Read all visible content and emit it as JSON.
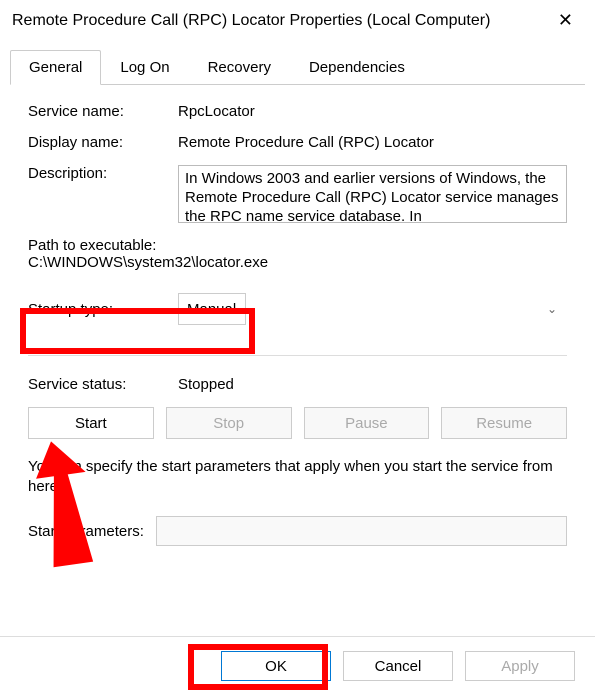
{
  "title": "Remote Procedure Call (RPC) Locator Properties (Local Computer)",
  "tabs": {
    "general": "General",
    "logon": "Log On",
    "recovery": "Recovery",
    "dependencies": "Dependencies"
  },
  "labels": {
    "service_name": "Service name:",
    "display_name": "Display name:",
    "description": "Description:",
    "path": "Path to executable:",
    "startup_type": "Startup type:",
    "service_status": "Service status:",
    "start_parameters": "Start parameters:"
  },
  "values": {
    "service_name": "RpcLocator",
    "display_name": "Remote Procedure Call (RPC) Locator",
    "description": "In Windows 2003 and earlier versions of Windows, the Remote Procedure Call (RPC) Locator service manages the RPC name service database. In",
    "path": "C:\\WINDOWS\\system32\\locator.exe",
    "startup_type": "Manual",
    "service_status": "Stopped",
    "start_parameters": ""
  },
  "buttons": {
    "start": "Start",
    "stop": "Stop",
    "pause": "Pause",
    "resume": "Resume",
    "ok": "OK",
    "cancel": "Cancel",
    "apply": "Apply"
  },
  "hint": "You can specify the start parameters that apply when you start the service from here."
}
